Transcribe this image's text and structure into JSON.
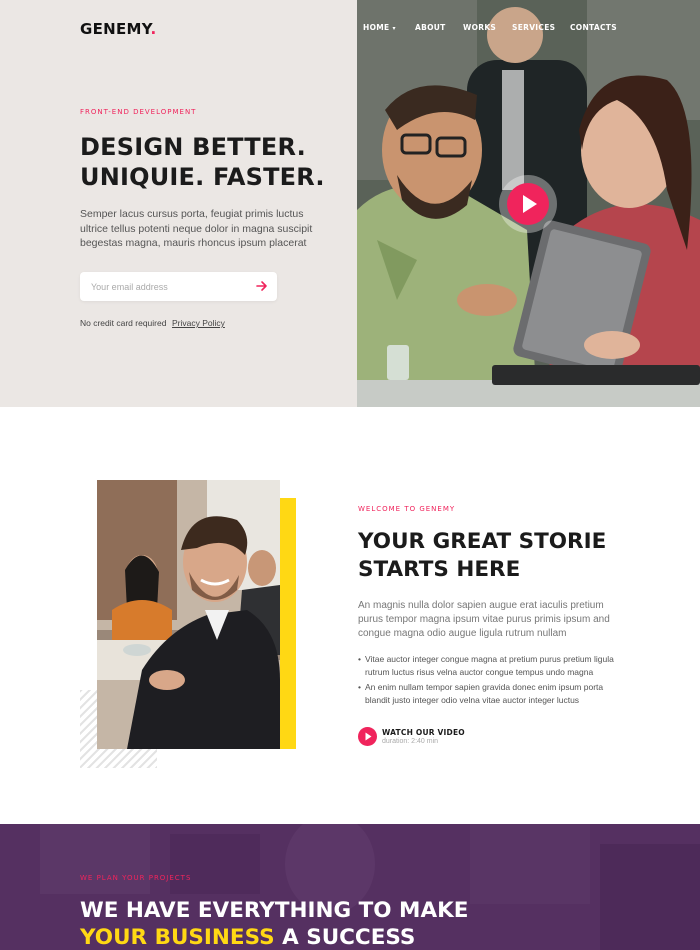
{
  "header": {
    "logo": "GENEMY",
    "logo_dot": ".",
    "nav": [
      {
        "label": "HOME",
        "has_dropdown": true
      },
      {
        "label": "ABOUT"
      },
      {
        "label": "WORKS"
      },
      {
        "label": "SERVICES"
      },
      {
        "label": "CONTACTS"
      }
    ]
  },
  "hero": {
    "eyebrow": "FRONT-END DEVELOPMENT",
    "title_line1": "DESIGN BETTER.",
    "title_line2": "UNIQUIE. FASTER.",
    "text": "Semper lacus cursus porta, feugiat primis luctus ultrice tellus potenti neque dolor in magna suscipit begestas magna, mauris rhoncus ipsum placerat",
    "email_placeholder": "Your email address",
    "email_value": "",
    "note": "No credit card required",
    "privacy_link": "Privacy Policy"
  },
  "about": {
    "eyebrow": "WELCOME TO GENEMY",
    "title_line1": "YOUR GREAT STORIE",
    "title_line2": "STARTS HERE",
    "text": "An magnis nulla dolor sapien augue erat iaculis pretium purus tempor magna ipsum vitae purus primis ipsum and congue magna odio augue ligula rutrum nullam",
    "bullets": [
      "Vitae auctor integer congue magna at pretium purus pretium ligula rutrum luctus risus velna auctor congue tempus undo magna",
      "An enim nullam tempor sapien gravida donec enim ipsum porta blandit justo integer odio velna vitae auctor integer luctus"
    ],
    "watch_label": "WATCH OUR VIDEO",
    "watch_duration": "duration: 2:40 min"
  },
  "plan": {
    "eyebrow": "WE PLAN YOUR PROJECTS",
    "title_line1": "WE HAVE EVERYTHING TO MAKE",
    "title_highlight": "YOUR BUSINESS",
    "title_rest": " A SUCCESS"
  },
  "colors": {
    "accent": "#f0245c",
    "yellow": "#ffd814",
    "purple": "#553061",
    "hero_bg": "#ebe7e4"
  },
  "icons": {
    "play": "play-icon",
    "submit": "arrow-right-icon",
    "dropdown": "chevron-down-icon"
  }
}
